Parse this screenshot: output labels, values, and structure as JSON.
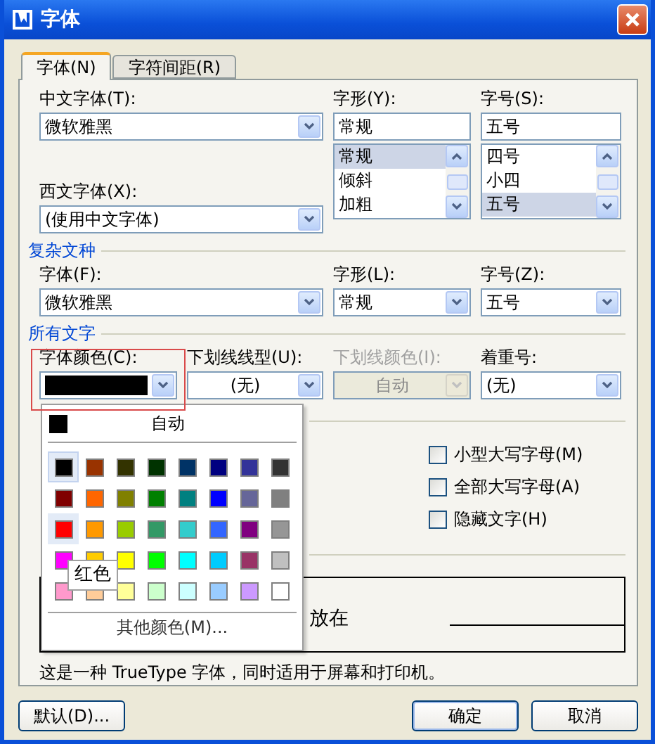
{
  "window": {
    "title": "字体"
  },
  "tabs": [
    {
      "label": "字体(N)",
      "selected": true
    },
    {
      "label": "字符间距(R)",
      "selected": false
    }
  ],
  "chinese_font": {
    "label": "中文字体(T):",
    "value": "微软雅黑"
  },
  "western_font": {
    "label": "西文字体(X):",
    "value": "(使用中文字体)"
  },
  "style": {
    "label": "字形(Y):",
    "value": "常规",
    "options": [
      {
        "label": "常规",
        "selected": true
      },
      {
        "label": "倾斜",
        "selected": false
      },
      {
        "label": "加粗",
        "selected": false
      }
    ]
  },
  "size": {
    "label": "字号(S):",
    "value": "五号",
    "options": [
      {
        "label": "四号",
        "selected": false
      },
      {
        "label": "小四",
        "selected": false
      },
      {
        "label": "五号",
        "selected": true
      }
    ]
  },
  "complex_script": {
    "heading": "复杂文种",
    "fields": [
      {
        "label": "字体(F):",
        "value": "微软雅黑"
      },
      {
        "label": "字形(L):",
        "value": "常规"
      },
      {
        "label": "字号(Z):",
        "value": "五号"
      }
    ]
  },
  "all_text": {
    "heading": "所有文字",
    "fields": [
      {
        "kind": "color",
        "label": "字体颜色(C):",
        "color": "#000000",
        "highlighted": true,
        "disabled": false
      },
      {
        "kind": "select",
        "label": "下划线线型(U):",
        "value": "(无)",
        "centered": true,
        "disabled": false
      },
      {
        "kind": "select",
        "label": "下划线颜色(I):",
        "value": "自动",
        "centered": true,
        "disabled": true
      },
      {
        "kind": "select",
        "label": "着重号:",
        "value": "(无)",
        "centered": false,
        "disabled": false
      }
    ]
  },
  "effects": {
    "checkboxes": [
      {
        "label": "小型大写字母(M)",
        "checked": false
      },
      {
        "label": "全部大写字母(A)",
        "checked": false
      },
      {
        "label": "隐藏文字(H)",
        "checked": false
      }
    ]
  },
  "preview": {
    "sample": "放在"
  },
  "description": "这是一种 TrueType 字体，同时适用于屏幕和打印机。",
  "color_menu": {
    "auto": {
      "label": "自动",
      "color": "#000000"
    },
    "more_label": "其他颜色(M)...",
    "tooltip": "红色",
    "swatches": [
      {
        "color": "#000000",
        "selected": true,
        "hovered": false
      },
      {
        "color": "#993300",
        "selected": false,
        "hovered": false
      },
      {
        "color": "#333300",
        "selected": false,
        "hovered": false
      },
      {
        "color": "#003300",
        "selected": false,
        "hovered": false
      },
      {
        "color": "#003366",
        "selected": false,
        "hovered": false
      },
      {
        "color": "#000080",
        "selected": false,
        "hovered": false
      },
      {
        "color": "#333399",
        "selected": false,
        "hovered": false
      },
      {
        "color": "#333333",
        "selected": false,
        "hovered": false
      },
      {
        "color": "#800000",
        "selected": false,
        "hovered": false
      },
      {
        "color": "#ff6600",
        "selected": false,
        "hovered": false
      },
      {
        "color": "#808000",
        "selected": false,
        "hovered": false
      },
      {
        "color": "#008000",
        "selected": false,
        "hovered": false
      },
      {
        "color": "#008080",
        "selected": false,
        "hovered": false
      },
      {
        "color": "#0000ff",
        "selected": false,
        "hovered": false
      },
      {
        "color": "#666699",
        "selected": false,
        "hovered": false
      },
      {
        "color": "#808080",
        "selected": false,
        "hovered": false
      },
      {
        "color": "#ff0000",
        "selected": false,
        "hovered": true
      },
      {
        "color": "#ff9900",
        "selected": false,
        "hovered": false
      },
      {
        "color": "#99cc00",
        "selected": false,
        "hovered": false
      },
      {
        "color": "#339966",
        "selected": false,
        "hovered": false
      },
      {
        "color": "#33cccc",
        "selected": false,
        "hovered": false
      },
      {
        "color": "#3366ff",
        "selected": false,
        "hovered": false
      },
      {
        "color": "#800080",
        "selected": false,
        "hovered": false
      },
      {
        "color": "#969696",
        "selected": false,
        "hovered": false
      },
      {
        "color": "#ff00ff",
        "selected": false,
        "hovered": false
      },
      {
        "color": "#ffcc00",
        "selected": false,
        "hovered": false
      },
      {
        "color": "#ffff00",
        "selected": false,
        "hovered": false
      },
      {
        "color": "#00ff00",
        "selected": false,
        "hovered": false
      },
      {
        "color": "#00ffff",
        "selected": false,
        "hovered": false
      },
      {
        "color": "#00ccff",
        "selected": false,
        "hovered": false
      },
      {
        "color": "#993366",
        "selected": false,
        "hovered": false
      },
      {
        "color": "#c0c0c0",
        "selected": false,
        "hovered": false
      },
      {
        "color": "#ff99cc",
        "selected": false,
        "hovered": false
      },
      {
        "color": "#ffcc99",
        "selected": false,
        "hovered": false
      },
      {
        "color": "#ffff99",
        "selected": false,
        "hovered": false
      },
      {
        "color": "#ccffcc",
        "selected": false,
        "hovered": false
      },
      {
        "color": "#ccffff",
        "selected": false,
        "hovered": false
      },
      {
        "color": "#99ccff",
        "selected": false,
        "hovered": false
      },
      {
        "color": "#cc99ff",
        "selected": false,
        "hovered": false
      },
      {
        "color": "#ffffff",
        "selected": false,
        "hovered": false
      }
    ]
  },
  "buttons": [
    {
      "label": "默认(D)...",
      "default": false
    },
    {
      "label": "确定",
      "default": true
    },
    {
      "label": "取消",
      "default": false
    }
  ]
}
